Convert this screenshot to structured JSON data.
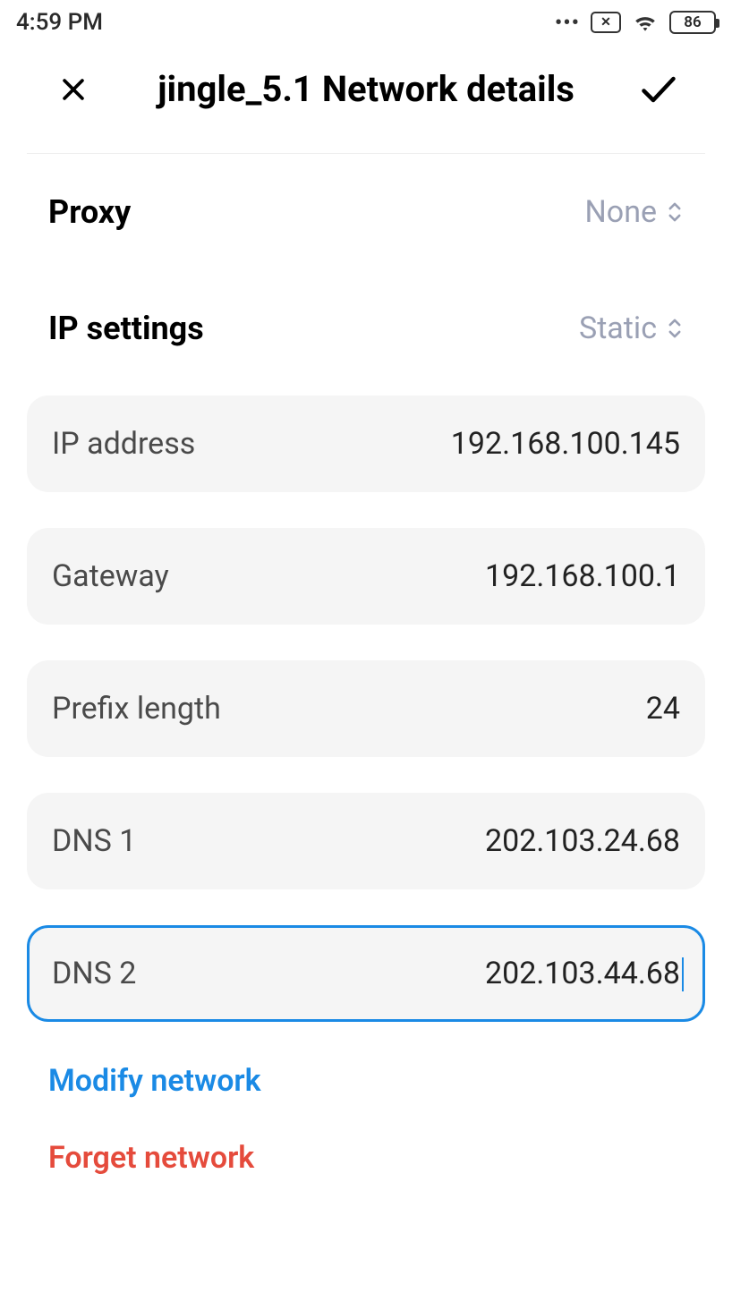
{
  "status": {
    "time": "4:59 PM",
    "sim": "✕",
    "battery": "86"
  },
  "header": {
    "title": "jingle_5.1 Network details"
  },
  "selectors": {
    "proxy": {
      "label": "Proxy",
      "value": "None"
    },
    "ip_settings": {
      "label": "IP settings",
      "value": "Static"
    }
  },
  "fields": {
    "ip_address": {
      "label": "IP address",
      "value": "192.168.100.145"
    },
    "gateway": {
      "label": "Gateway",
      "value": "192.168.100.1"
    },
    "prefix_length": {
      "label": "Prefix length",
      "value": "24"
    },
    "dns1": {
      "label": "DNS 1",
      "value": "202.103.24.68"
    },
    "dns2": {
      "label": "DNS 2",
      "value": "202.103.44.68"
    }
  },
  "actions": {
    "modify": "Modify network",
    "forget": "Forget network"
  }
}
